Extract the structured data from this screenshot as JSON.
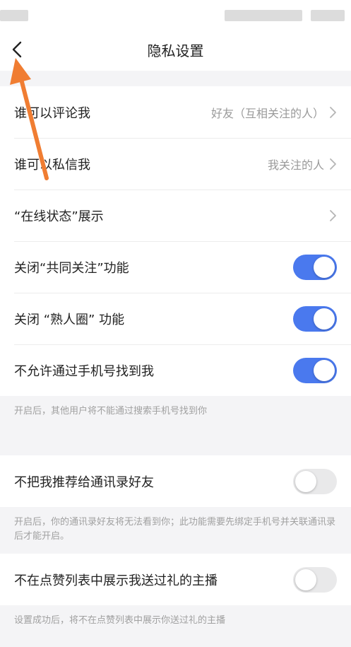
{
  "header": {
    "title": "隐私设置",
    "back_icon": "chevron-left-icon"
  },
  "settings": [
    {
      "label": "谁可以评论我",
      "value": "好友（互相关注的人）"
    },
    {
      "label": "谁可以私信我",
      "value": "我关注的人"
    },
    {
      "label": "“在线状态”展示",
      "value": ""
    }
  ],
  "toggles_group1": [
    {
      "label": "关闭“共同关注”功能",
      "on": true
    },
    {
      "label": "关闭 “熟人圈” 功能",
      "on": true
    },
    {
      "label": "不允许通过手机号找到我",
      "on": true
    }
  ],
  "note1": "开启后，其他用户将不能通过搜索手机号找到你",
  "contacts": {
    "label": "不把我推荐给通讯录好友",
    "on": false
  },
  "note2": "开启后，你的通讯录好友将无法看到你；此功能需要先绑定手机号并关联通讯录后才能开启。",
  "likes": {
    "label": "不在点赞列表中展示我送过礼的主播",
    "on": false
  },
  "note3": "设置成功后，将不在点赞列表中展示你送过礼的主播",
  "colors": {
    "accent": "#4a79ee",
    "arrow": "#f07d32"
  }
}
